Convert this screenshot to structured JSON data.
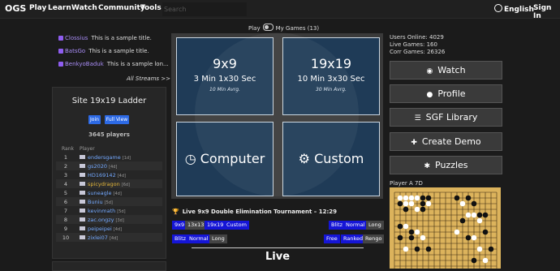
{
  "nav": {
    "logo": "OGS",
    "items": [
      "Play",
      "Learn",
      "Watch",
      "Community",
      "Tools"
    ],
    "search_placeholder": "Search",
    "language": "English",
    "sign_in": "Sign In"
  },
  "streams": [
    {
      "channel": "Clossius",
      "title": "This is a sample title."
    },
    {
      "channel": "BatsGo",
      "title": "This is a sample title."
    },
    {
      "channel": "BenkyoBaduk",
      "title": "This is a sample lon..."
    }
  ],
  "all_streams": "All Streams >>",
  "ladder": {
    "title": "Site 19x19 Ladder",
    "join": "Join",
    "full_view": "Full View",
    "players": "3645 players",
    "col_rank": "Rank",
    "col_player": "Player",
    "rows": [
      {
        "rank": "1",
        "name": "endersgame",
        "rating": "[1d]"
      },
      {
        "rank": "2",
        "name": "gs2020",
        "rating": "[4d]"
      },
      {
        "rank": "3",
        "name": "HD169142",
        "rating": "[4d]"
      },
      {
        "rank": "4",
        "name": "spicydragon",
        "rating": "[6d]"
      },
      {
        "rank": "5",
        "name": "suneagle",
        "rating": "[4d]"
      },
      {
        "rank": "6",
        "name": "Buniu",
        "rating": "[5d]"
      },
      {
        "rank": "7",
        "name": "kevinmath",
        "rating": "[5d]"
      },
      {
        "rank": "8",
        "name": "zac.ongzy",
        "rating": "[3d]"
      },
      {
        "rank": "9",
        "name": "peipeipei",
        "rating": "[4d]"
      },
      {
        "rank": "10",
        "name": "zixlei07",
        "rating": "[4d]"
      }
    ]
  },
  "play": {
    "toggle_left": "Play",
    "toggle_right": "My Games (13)",
    "tile_9": {
      "size": "9x9",
      "time": "3 Min 1x30 Sec",
      "avg": "10 Min Avrg."
    },
    "tile_19": {
      "size": "19x19",
      "time": "10 Min 3x30 Sec",
      "avg": "30 Min Avrg."
    },
    "computer": "Computer",
    "custom": "Custom"
  },
  "tournament": {
    "title": "Live 9x9 Double Elimination Tournament – 12:29",
    "sizes": [
      "9x9",
      "13x13",
      "19x19",
      "Custom"
    ],
    "speeds_right": [
      "Blitz",
      "Normal",
      "Long"
    ],
    "speeds_left": [
      "Blitz",
      "Normal",
      "Long"
    ],
    "ranked": [
      "Free",
      "Ranked",
      "Rengo"
    ]
  },
  "live_heading": "Live",
  "stats": {
    "online": "Users Online: 4029",
    "live_games": "Live Games: 160",
    "corr_games": "Corr Games: 26326"
  },
  "right_buttons": [
    "Watch",
    "Profile",
    "SGF Library",
    "Create Demo",
    "Puzzles"
  ],
  "player_a": "Player A 7D"
}
